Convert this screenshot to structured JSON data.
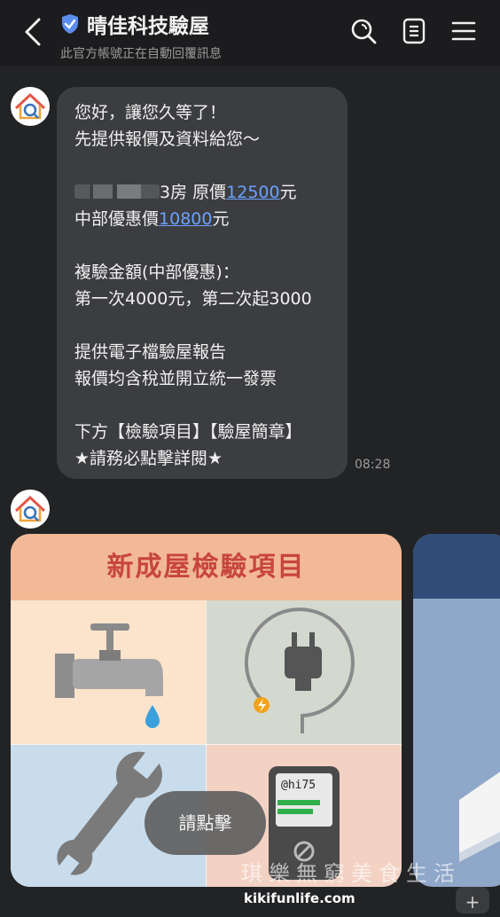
{
  "header": {
    "title": "晴佳科技驗屋",
    "subtitle": "此官方帳號正在自動回覆訊息",
    "icons": [
      "back-icon",
      "verified-shield-icon",
      "search-icon",
      "notes-icon",
      "menu-icon"
    ]
  },
  "message": {
    "lines": [
      "您好，讓您久等了！",
      "先提供報價及資料給您～"
    ],
    "price_line_suffix": "3房 原價",
    "original_price": "12500",
    "yuan1": "元",
    "special_label": "中部優惠價",
    "special_price": "10800",
    "yuan2": "元",
    "reinspect_title": "複驗金額(中部優惠)：",
    "reinspect_detail": "第一次4000元，第二次起3000",
    "report_line": "提供電子檔驗屋報告",
    "tax_line": "報價均含稅並開立統一發票",
    "below_line": "下方【檢驗項目】【驗屋簡章】",
    "must_click_line": "★請務必點擊詳閱★",
    "time": "08:28"
  },
  "card": {
    "title": "新成屋檢驗項目",
    "cta_label": "請點擊",
    "meter_text": "@hi75",
    "title_color": "#c8453d"
  },
  "watermark": {
    "text": "琪樂無窮美食生活",
    "site": "kikifunlife.com"
  },
  "plus_label": "+"
}
